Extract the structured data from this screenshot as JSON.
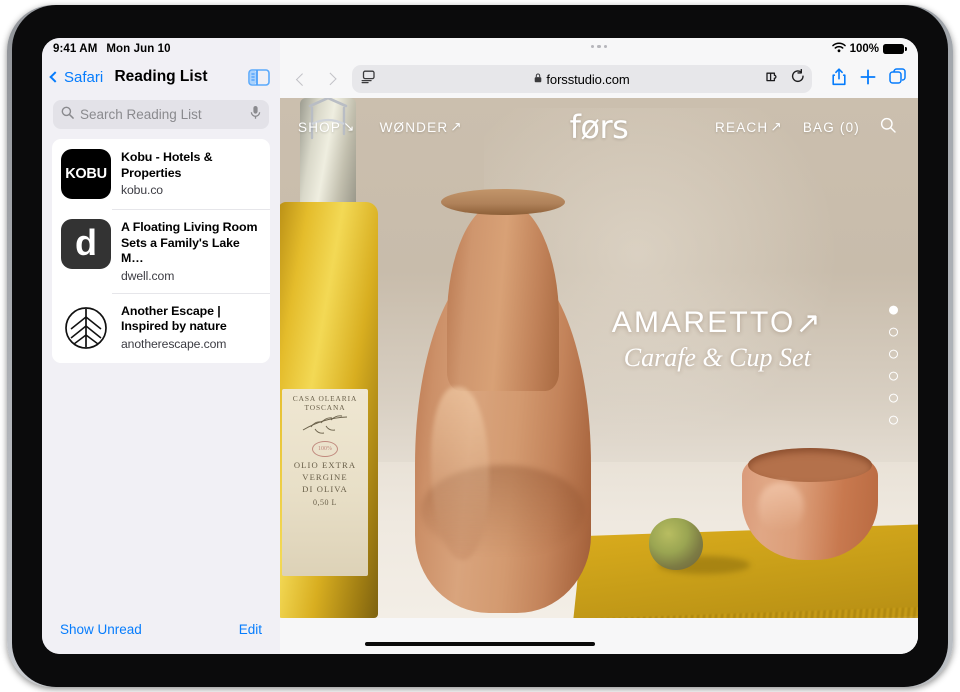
{
  "status_bar": {
    "time": "9:41 AM",
    "date": "Mon Jun 10",
    "battery_percent": "100%",
    "wifi_icon": "wifi-icon",
    "battery_icon": "battery-full-icon"
  },
  "sidebar": {
    "back_label": "Safari",
    "title": "Reading List",
    "toggle_icon": "sidebar-toggle-icon",
    "search": {
      "placeholder": "Search Reading List",
      "search_icon": "search-icon",
      "mic_icon": "microphone-icon"
    },
    "items": [
      {
        "title": "Kobu - Hotels & Properties",
        "host": "kobu.co",
        "icon_label": "KOBU",
        "icon_name": "kobu-favicon"
      },
      {
        "title": "A Floating Living Room Sets a Family's Lake M…",
        "host": "dwell.com",
        "icon_label": "d",
        "icon_name": "dwell-favicon"
      },
      {
        "title": "Another Escape | Inspired by nature",
        "host": "anotherescape.com",
        "icon_label": "",
        "icon_name": "another-escape-leaf-favicon"
      }
    ],
    "footer": {
      "show_unread": "Show Unread",
      "edit": "Edit"
    }
  },
  "browser": {
    "back_icon": "chevron-left-icon",
    "forward_icon": "chevron-right-icon",
    "reader_icon": "reader-view-icon",
    "lock_icon": "lock-icon",
    "url": "forsstudio.com",
    "extensions_icon": "extensions-puzzle-icon",
    "reload_icon": "reload-icon",
    "share_icon": "share-icon",
    "new_tab_icon": "plus-icon",
    "tabs_icon": "tab-overview-icon",
    "multitask_icon": "multitasking-dots-icon"
  },
  "webpage": {
    "brand": "førs",
    "nav_left": [
      {
        "label": "SHOP",
        "arrow": "↘"
      },
      {
        "label": "WØNDER",
        "arrow": "↗"
      }
    ],
    "nav_right": [
      {
        "label": "REACH",
        "arrow": "↗"
      },
      {
        "label": "BAG (0)",
        "arrow": ""
      }
    ],
    "search_icon": "search-icon",
    "hero": {
      "title": "AMARETTO",
      "title_arrow": "↗",
      "subtitle": "Carafe & Cup Set"
    },
    "carousel": {
      "total_dots": 6,
      "active_index": 0
    },
    "product_photo": {
      "bottle_label_brand": "CASA OLEARIA TOSCANA",
      "bottle_label_stamp": "100%",
      "bottle_label_line1": "OLIO EXTRA",
      "bottle_label_line2": "VERGINE",
      "bottle_label_line3": "DI OLIVA",
      "bottle_label_volume": "0,50 L"
    }
  },
  "colors": {
    "accent_blue": "#067cfc",
    "sidebar_bg": "#f1f0f5",
    "page_backdrop": "#c7bba9",
    "terracotta": "#cc8d64",
    "cloth_yellow": "#caa019"
  }
}
